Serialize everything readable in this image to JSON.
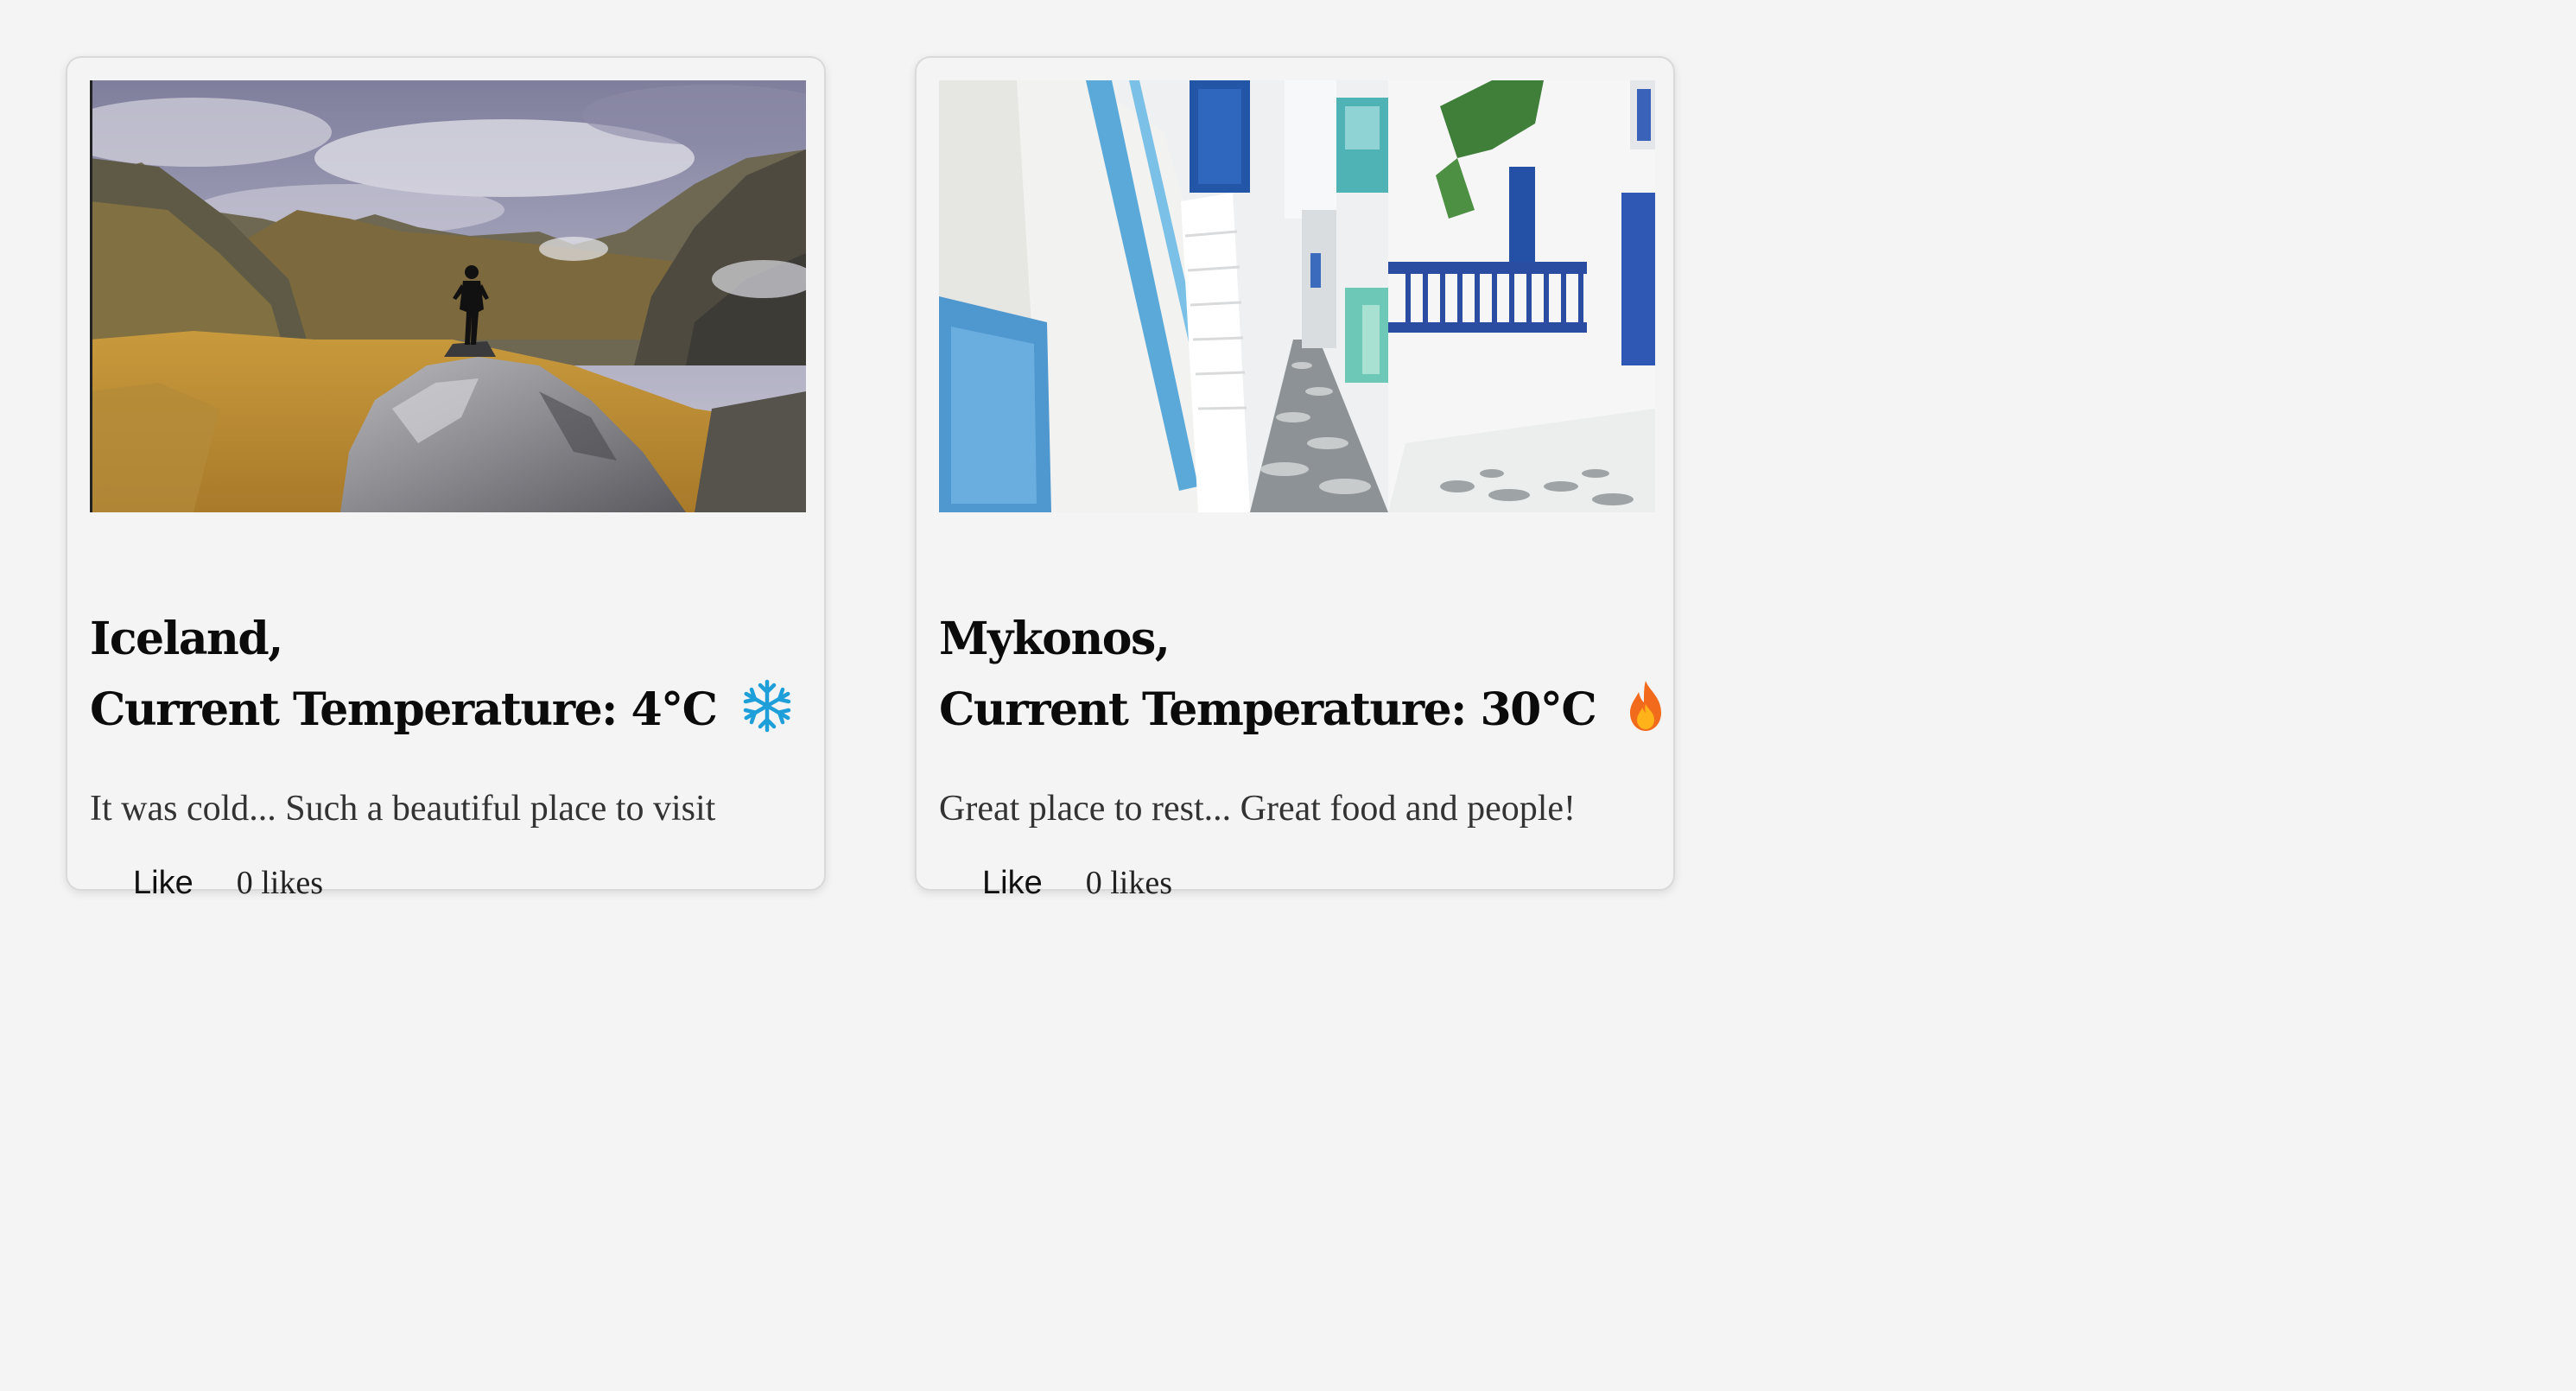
{
  "cards": [
    {
      "location": "Iceland,",
      "temperature_text": "Current Temperature: 4°C",
      "weather_icon": "snowflake-icon",
      "description": "It was cold... Such a beautiful place to visit",
      "like_label": "Like",
      "likes_text": "0 likes"
    },
    {
      "location": "Mykonos,",
      "temperature_text": "Current Temperature: 30°C",
      "weather_icon": "fire-icon",
      "description": "Great place to rest... Great food and people!",
      "like_label": "Like",
      "likes_text": "0 likes"
    }
  ],
  "colors": {
    "background": "#f4f4f4",
    "card_border": "#d9d9d9",
    "snowflake": "#1f9fd9",
    "fire_outer": "#f26b1d",
    "fire_inner": "#ffb21a"
  }
}
